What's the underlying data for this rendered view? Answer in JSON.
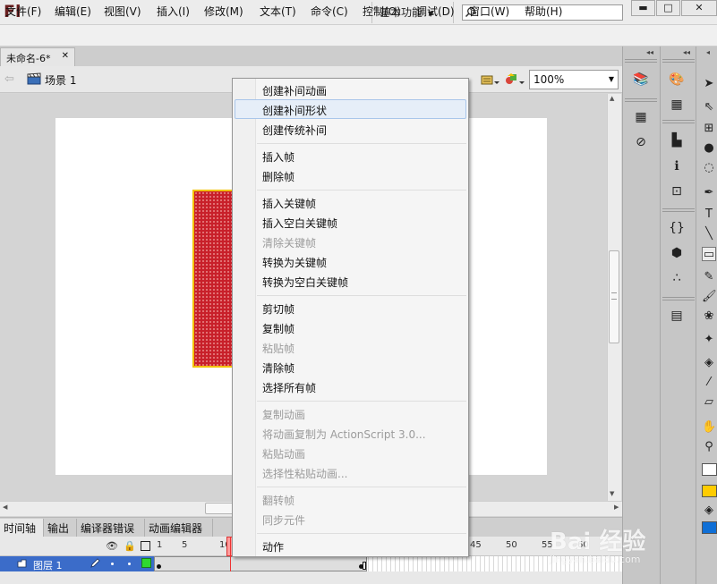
{
  "app": {
    "logo": "Fl",
    "workspace": "基本功能",
    "search_value": ""
  },
  "menubar": {
    "items": [
      "文件(F)",
      "编辑(E)",
      "视图(V)",
      "插入(I)",
      "修改(M)",
      "文本(T)",
      "命令(C)",
      "控制(O)",
      "调试(D)",
      "窗口(W)",
      "帮助(H)"
    ]
  },
  "document": {
    "tab_title": "未命名-6*",
    "scene": "场景 1",
    "zoom": "100%"
  },
  "context_menu": {
    "items": [
      {
        "label": "创建补间动画",
        "enabled": true
      },
      {
        "label": "创建补间形状",
        "enabled": true,
        "highlighted": true
      },
      {
        "label": "创建传统补间",
        "enabled": true
      },
      {
        "label": "插入帧",
        "enabled": true
      },
      {
        "label": "删除帧",
        "enabled": true
      },
      {
        "label": "插入关键帧",
        "enabled": true
      },
      {
        "label": "插入空白关键帧",
        "enabled": true
      },
      {
        "label": "清除关键帧",
        "enabled": false
      },
      {
        "label": "转换为关键帧",
        "enabled": true
      },
      {
        "label": "转换为空白关键帧",
        "enabled": true
      },
      {
        "label": "剪切帧",
        "enabled": true
      },
      {
        "label": "复制帧",
        "enabled": true
      },
      {
        "label": "粘贴帧",
        "enabled": false
      },
      {
        "label": "清除帧",
        "enabled": true
      },
      {
        "label": "选择所有帧",
        "enabled": true
      },
      {
        "label": "复制动画",
        "enabled": false
      },
      {
        "label": "将动画复制为 ActionScript 3.0...",
        "enabled": false
      },
      {
        "label": "粘贴动画",
        "enabled": false
      },
      {
        "label": "选择性粘贴动画...",
        "enabled": false
      },
      {
        "label": "翻转帧",
        "enabled": false
      },
      {
        "label": "同步元件",
        "enabled": false
      },
      {
        "label": "动作",
        "enabled": true
      }
    ]
  },
  "bottom_panel": {
    "tabs": [
      "时间轴",
      "输出",
      "编译器错误",
      "动画编辑器"
    ],
    "active_tab": "时间轴",
    "frame_numbers": [
      "1",
      "5",
      "10",
      "45",
      "50",
      "55",
      "60"
    ],
    "layer": {
      "name": "图层 1",
      "color": "#2fd92f"
    }
  },
  "colors": {
    "stroke": "#ffffff",
    "fill": "#ffcc00",
    "shape_fill": "#c8202a",
    "shape_stroke": "#f2c200",
    "layer_selected": "#3b6cc9"
  },
  "watermark": {
    "logo": "Bai 经验",
    "text": "jingyan.baidu.com"
  }
}
